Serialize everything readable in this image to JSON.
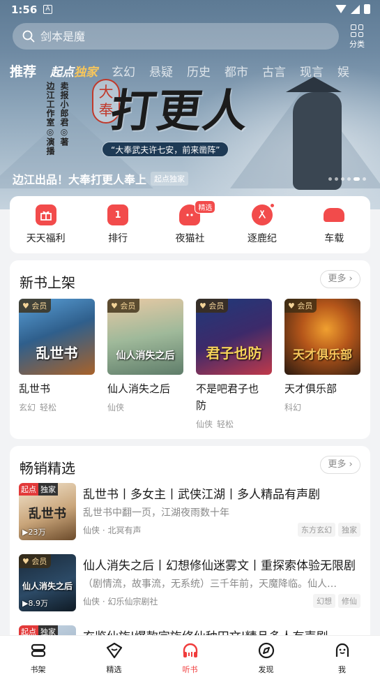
{
  "status_bar": {
    "time": "1:56",
    "app_badge": "A"
  },
  "search": {
    "placeholder": "剑本是魔"
  },
  "category_button": {
    "label": "分类"
  },
  "tabs": [
    {
      "label": "推荐"
    },
    {
      "label": "起点",
      "accent": "独家"
    },
    {
      "label": "玄幻"
    },
    {
      "label": "悬疑"
    },
    {
      "label": "历史"
    },
    {
      "label": "都市"
    },
    {
      "label": "古言"
    },
    {
      "label": "现言"
    },
    {
      "label": "娱"
    }
  ],
  "banner": {
    "title": "打更人",
    "seal": [
      "大",
      "奉"
    ],
    "author_credit": "卖报小郎君◎著",
    "studio_credit": "边江工作室◎演播",
    "quote": "“大奉武夫许七安，前来凿阵”",
    "caption": "边江出品！大奉打更人奉上",
    "caption_tag": "起点独家",
    "slide_count": 6,
    "active_slide": 4
  },
  "quick_entries": [
    {
      "label": "天天福利",
      "icon": "gift-icon"
    },
    {
      "label": "排行",
      "icon": "rank-icon",
      "glyph": "1"
    },
    {
      "label": "夜猫社",
      "icon": "cat-icon",
      "badge": "精选"
    },
    {
      "label": "逐鹿纪",
      "icon": "deer-icon"
    },
    {
      "label": "车载",
      "icon": "car-icon"
    }
  ],
  "new_books": {
    "title": "新书上架",
    "more": "更多",
    "vip_label": "会员",
    "items": [
      {
        "title": "乱世书",
        "tags": [
          "玄幻",
          "轻松"
        ],
        "cover_text": "乱世书"
      },
      {
        "title": "仙人消失之后",
        "tags": [
          "仙侠"
        ],
        "cover_text": "仙人消失之后"
      },
      {
        "title": "不是吧君子也防",
        "tags": [
          "仙侠",
          "轻松"
        ],
        "cover_text": "君子也防"
      },
      {
        "title": "天才俱乐部",
        "tags": [
          "科幻"
        ],
        "cover_text": "天才俱乐部"
      }
    ]
  },
  "bestsellers": {
    "title": "畅销精选",
    "more": "更多",
    "items": [
      {
        "title": "乱世书丨多女主丨武侠江湖丨多人精品有声剧",
        "desc": "乱世书中翻一页，江湖夜雨数十年",
        "meta": "仙侠 · 北冥有声",
        "plays": "▶23万",
        "tag_a": "起点",
        "tag_b": "独家",
        "chips": [
          "东方玄幻",
          "独家"
        ],
        "cover_text": "乱世书"
      },
      {
        "title": "仙人消失之后丨幻想修仙迷雾文丨重探索体验无限剧",
        "desc": "（剧情流，故事流，无系统）三千年前，天魔降临。仙人…",
        "meta": "仙侠 · 幻乐仙宗剧社",
        "plays": "▶8.9万",
        "vip": "会员",
        "chips": [
          "幻想",
          "修仙"
        ],
        "cover_text": "仙人消失之后"
      },
      {
        "title": "玄鉴仙族|爆款宗族修仙种田文|精品多人有声剧",
        "tag_a": "起点",
        "tag_b": "独家"
      }
    ]
  },
  "bottom_nav": [
    {
      "label": "书架",
      "icon": "bookshelf-icon"
    },
    {
      "label": "精选",
      "icon": "featured-icon"
    },
    {
      "label": "听书",
      "icon": "headphones-icon",
      "active": true
    },
    {
      "label": "发现",
      "icon": "compass-icon"
    },
    {
      "label": "我",
      "icon": "profile-icon"
    }
  ],
  "colors": {
    "accent": "#f03c3c",
    "brand_gold": "#f7c65b"
  }
}
